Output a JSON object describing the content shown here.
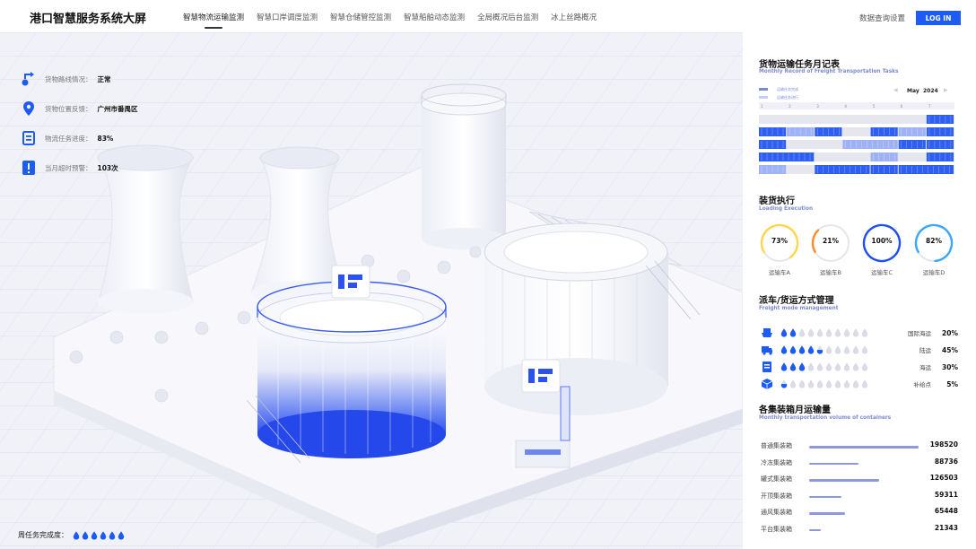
{
  "header": {
    "title": "港口智慧服务系统大屏",
    "nav": [
      "智慧物流运输监测",
      "智慧口岸调度监测",
      "智慧仓储管控监测",
      "智慧船舶动态监测",
      "全局概况后台监测",
      "冰上丝路概况"
    ],
    "active_nav": 0,
    "settings": "数据查询设置",
    "login": "LOG IN"
  },
  "info": {
    "route_label": "货物路线情况：",
    "route_value": "正常",
    "location_label": "货物位置反馈：",
    "location_value": "广州市番禺区",
    "progress_label": "物流任务进度：",
    "progress_value": "83%",
    "warning_label": "当月超时预警：",
    "warning_value": "103次"
  },
  "weekly": {
    "label": "周任务完成度：",
    "completed": 6,
    "total": 6
  },
  "monthly": {
    "title": "货物运输任务月记表",
    "subtitle": "Monthly Record of Freight Transportation Tasks",
    "month": "May",
    "year": "2024",
    "legend_a": "运输任务完成",
    "legend_b": "运输任务进行",
    "days": [
      "1",
      "2",
      "3",
      "4",
      "5",
      "6",
      "7"
    ]
  },
  "loading": {
    "title": "装货执行",
    "subtitle": "Loading Execution",
    "gauges": [
      {
        "label": "运输车A",
        "value": "73%",
        "pct": 73,
        "color": "#ffd64a"
      },
      {
        "label": "运输车B",
        "value": "21%",
        "pct": 21,
        "color": "#ff8a2a"
      },
      {
        "label": "运输车C",
        "value": "100%",
        "pct": 100,
        "color": "#1d4ff5"
      },
      {
        "label": "运输车D",
        "value": "82%",
        "pct": 82,
        "color": "#3aa6ff"
      }
    ]
  },
  "freight": {
    "title": "派车/货运方式管理",
    "subtitle": "Freight mode management",
    "modes": [
      {
        "name": "国际海运",
        "pct": "20%",
        "filled": 2,
        "icon": "ship-icon"
      },
      {
        "name": "陆运",
        "pct": "45%",
        "filled": 4.5,
        "icon": "truck-icon"
      },
      {
        "name": "海运",
        "pct": "30%",
        "filled": 3,
        "icon": "cargo-icon"
      },
      {
        "name": "补给点",
        "pct": "5%",
        "filled": 0.5,
        "icon": "box-icon"
      }
    ],
    "total_drops": 10
  },
  "containers": {
    "title": "各集装箱月运输量",
    "subtitle": "Monthly transportation volume of containers",
    "max": 198520,
    "items": [
      {
        "name": "普通集装箱",
        "value": "198520",
        "num": 198520
      },
      {
        "name": "冷冻集装箱",
        "value": "88736",
        "num": 88736
      },
      {
        "name": "罐式集装箱",
        "value": "126503",
        "num": 126503
      },
      {
        "name": "开顶集装箱",
        "value": "59311",
        "num": 59311
      },
      {
        "name": "通风集装箱",
        "value": "65448",
        "num": 65448
      },
      {
        "name": "平台集装箱",
        "value": "21343",
        "num": 21343
      }
    ]
  },
  "colors": {
    "accent": "#1d5bf5",
    "bar": "#8d99da",
    "muted": "#7b8ccf"
  }
}
